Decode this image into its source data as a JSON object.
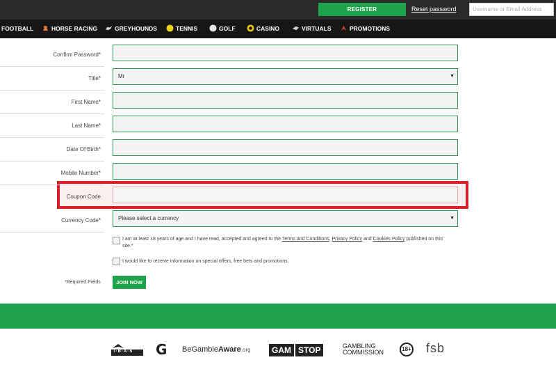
{
  "topbar": {
    "register_label": "REGISTER",
    "reset_password_label": "Reset password",
    "login_placeholder": "Username or Email Address"
  },
  "nav": {
    "items": [
      {
        "label": "FOOTBALL",
        "icon": "football-icon"
      },
      {
        "label": "HORSE RACING",
        "icon": "horse-icon"
      },
      {
        "label": "GREYHOUNDS",
        "icon": "greyhound-icon"
      },
      {
        "label": "TENNIS",
        "icon": "tennis-ball-icon"
      },
      {
        "label": "GOLF",
        "icon": "golf-ball-icon"
      },
      {
        "label": "CASINO",
        "icon": "casino-chip-icon"
      },
      {
        "label": "VIRTUALS",
        "icon": "virtuals-icon"
      },
      {
        "label": "PROMOTIONS",
        "icon": "promotions-icon"
      }
    ]
  },
  "form": {
    "confirm_password_label": "Confirm Password*",
    "title_label": "Title*",
    "title_value": "Mr",
    "first_name_label": "First Name*",
    "last_name_label": "Last Name*",
    "dob_label": "Date Of Birth*",
    "mobile_label": "Mobile Number*",
    "coupon_label": "Coupon Code",
    "currency_label": "Currency Code*",
    "currency_value": "Please select a currency",
    "terms_text_1": "I am at least 18 years of age and I have read, accepted and agreed to the ",
    "terms_link": "Terms and Conditions",
    "terms_sep": ", ",
    "privacy_link": "Privacy Policy",
    "and_text": " and ",
    "cookies_link": "Cookies Policy",
    "terms_text_2": " published on this site.*",
    "offers_text": "I would like to receive information on special offers, free bets and promotions.",
    "required_note": "*Required Fields",
    "join_label": "JOIN NOW"
  },
  "footer": {
    "ibas": "I·B·A·S",
    "gamcare": "G",
    "begambleaware_be": "BeGamble",
    "begambleaware_aware": "Aware",
    "begambleaware_org": ".org",
    "gamstop_gam": "GAM",
    "gamstop_stop": "STOP",
    "commission_line1": "GAMBLING",
    "commission_line2": "COMMISSION",
    "age": "18+",
    "fsb": "fsb"
  },
  "colors": {
    "accent_green": "#1fa34a",
    "highlight_red": "#d91f2a"
  }
}
